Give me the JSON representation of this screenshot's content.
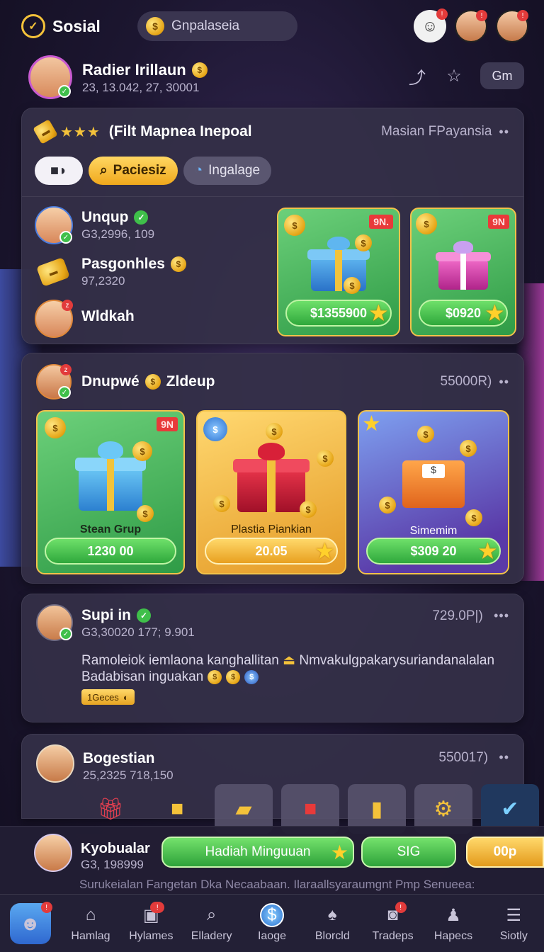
{
  "header": {
    "app_title": "Sosial",
    "search_value": "Gnpalaseia"
  },
  "profile": {
    "name": "Radier Irillaun",
    "subtitle": "23, 13.042, 27, 30001",
    "gm_label": "Gm"
  },
  "card1": {
    "title": "(Filt Mapnea Inepoal",
    "stars": "★★★",
    "right_text": "Masian FPayansia",
    "more": "••",
    "pills": [
      {
        "label": ""
      },
      {
        "label": "Paciesiz"
      },
      {
        "label": "Ingalage"
      }
    ],
    "users": [
      {
        "name": "Unqup",
        "sub": "G3,2996, 109"
      },
      {
        "name": "Pasgonhles",
        "sub": "97,2320"
      },
      {
        "name": "Wldkah",
        "sub": ""
      }
    ],
    "gifts": [
      {
        "tag": "9N.",
        "price": "$1355900"
      },
      {
        "tag": "9N",
        "price": "$0920"
      }
    ]
  },
  "card2": {
    "title_a": "Dnupwé",
    "title_b": "Zldeup",
    "right_text": "55000R)",
    "more": "••",
    "gifts": [
      {
        "tag": "9N",
        "label": "Stean Grup",
        "price": "1230 00"
      },
      {
        "tag": "",
        "label": "Plastia  Piankian",
        "price": "20.05"
      },
      {
        "tag": "",
        "label": "Simemim",
        "price": "$309 20"
      }
    ]
  },
  "card3": {
    "name": "Supi in",
    "sub": "G3,30020 177; 9.901",
    "right_text": "729.0P|)",
    "more": "•••",
    "line1": "Ramoleiok iemlaona kanghallitan",
    "line1b": "Nmvakulgpakarysuriandanalalan",
    "line2": "Badabisan inguakan",
    "chip": "1Geces"
  },
  "card4": {
    "name": "Bogestian",
    "sub": "25,2325 718,150",
    "right_text": "550017)",
    "more": "••"
  },
  "promo": {
    "name": "Kyobualar",
    "sub": "G3, 198999",
    "primary_label": "Hadiah Minguuan",
    "secondary_label": "SIG",
    "tertiary_label": "00p",
    "footer_text": "Surukeialan Fangetan Dka Necaabaan. Ilaraallsyaraumgnt Pmp Senueea:"
  },
  "nav": {
    "items": [
      {
        "label": "",
        "icon": "mascot-icon"
      },
      {
        "label": "Hamlag",
        "icon": "home-icon"
      },
      {
        "label": "Hylames",
        "icon": "games-icon"
      },
      {
        "label": "Elladery",
        "icon": "search-icon"
      },
      {
        "label": "Iaoge",
        "icon": "dollar-icon"
      },
      {
        "label": "Blorcld",
        "icon": "leaf-icon"
      },
      {
        "label": "Tradeps",
        "icon": "trade-icon"
      },
      {
        "label": "Hapecs",
        "icon": "person-icon"
      },
      {
        "label": "Siotly",
        "icon": "menu-icon"
      }
    ]
  },
  "colors": {
    "accent_gold": "#f4c23a",
    "accent_green": "#3fbf4a",
    "badge_red": "#e23b3b",
    "card_bg": "#343048"
  }
}
